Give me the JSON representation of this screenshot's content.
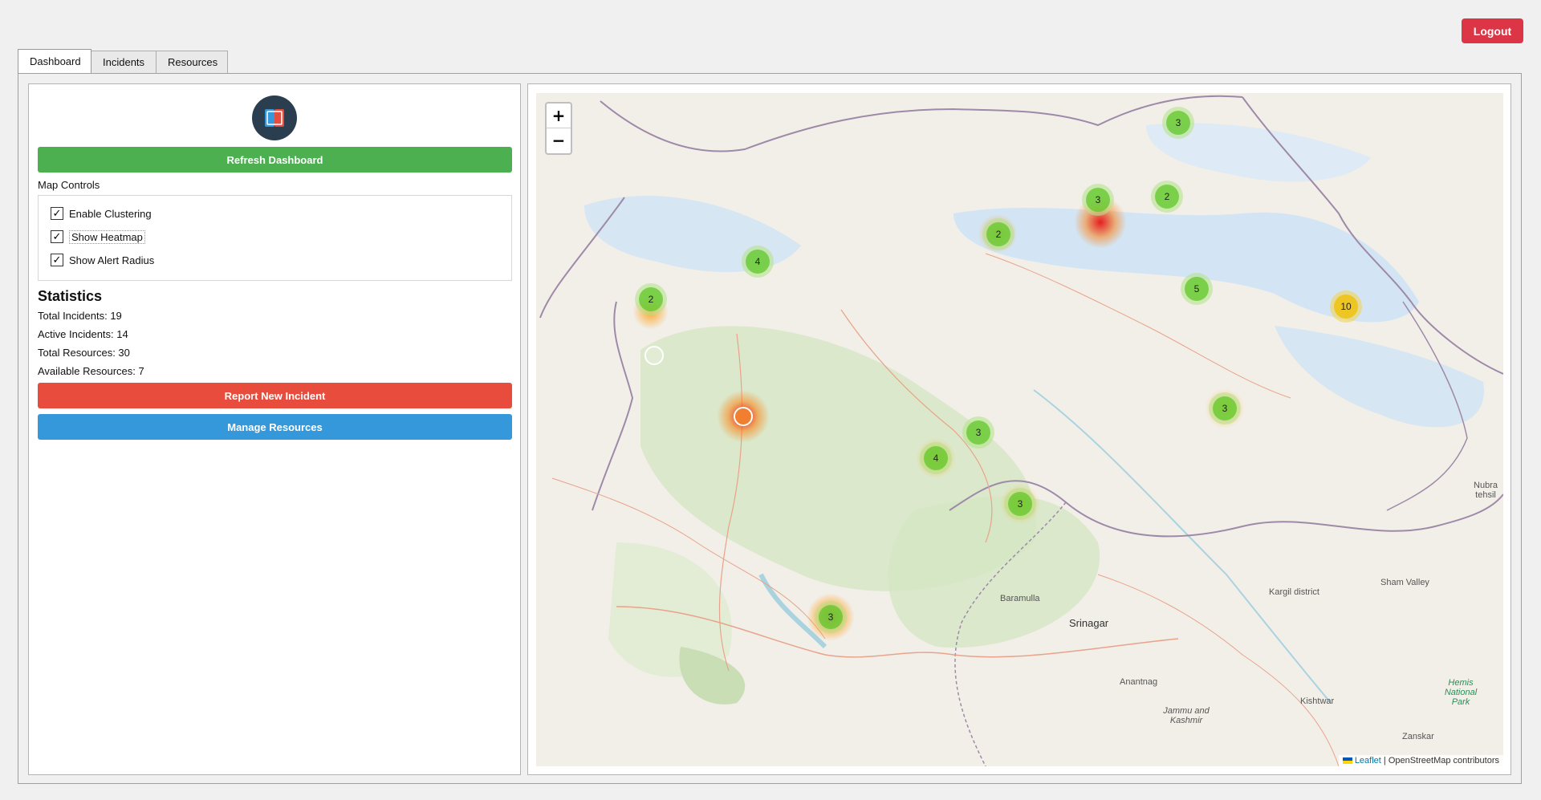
{
  "header": {
    "logout_label": "Logout"
  },
  "tabs": [
    {
      "label": "Dashboard",
      "active": true
    },
    {
      "label": "Incidents",
      "active": false
    },
    {
      "label": "Resources",
      "active": false
    }
  ],
  "sidebar": {
    "refresh_label": "Refresh Dashboard",
    "map_controls_label": "Map Controls",
    "controls": [
      {
        "label": "Enable Clustering",
        "checked": true
      },
      {
        "label": "Show Heatmap",
        "checked": true
      },
      {
        "label": "Show Alert Radius",
        "checked": true
      }
    ],
    "statistics_title": "Statistics",
    "stats": [
      "Total Incidents: 19",
      "Active Incidents: 14",
      "Total Resources: 30",
      "Available Resources: 7"
    ],
    "report_label": "Report New Incident",
    "manage_label": "Manage Resources"
  },
  "map": {
    "zoom_in": "+",
    "zoom_out": "−",
    "attribution_link": "Leaflet",
    "attribution_rest": " | OpenStreetMap contributors",
    "clusters": [
      "3",
      "2",
      "3",
      "2",
      "4",
      "5",
      "10",
      "2",
      "3",
      "3",
      "4",
      "3",
      "3"
    ],
    "labels": {
      "srinagar": "Srinagar",
      "baramulla": "Baramulla",
      "anantnag": "Anantnag",
      "kargil": "Kargil district",
      "sham_valley": "Sham Valley",
      "nubra": "Nubra tehsil",
      "hemis": "Hemis National Park",
      "kishtwar": "Kishtwar",
      "zanskar": "Zanskar",
      "jammu_kashmir": "Jammu and Kashmir"
    }
  },
  "colors": {
    "green": "#4caf50",
    "red": "#e74c3c",
    "blue": "#3498db",
    "logout": "#dc3545"
  }
}
